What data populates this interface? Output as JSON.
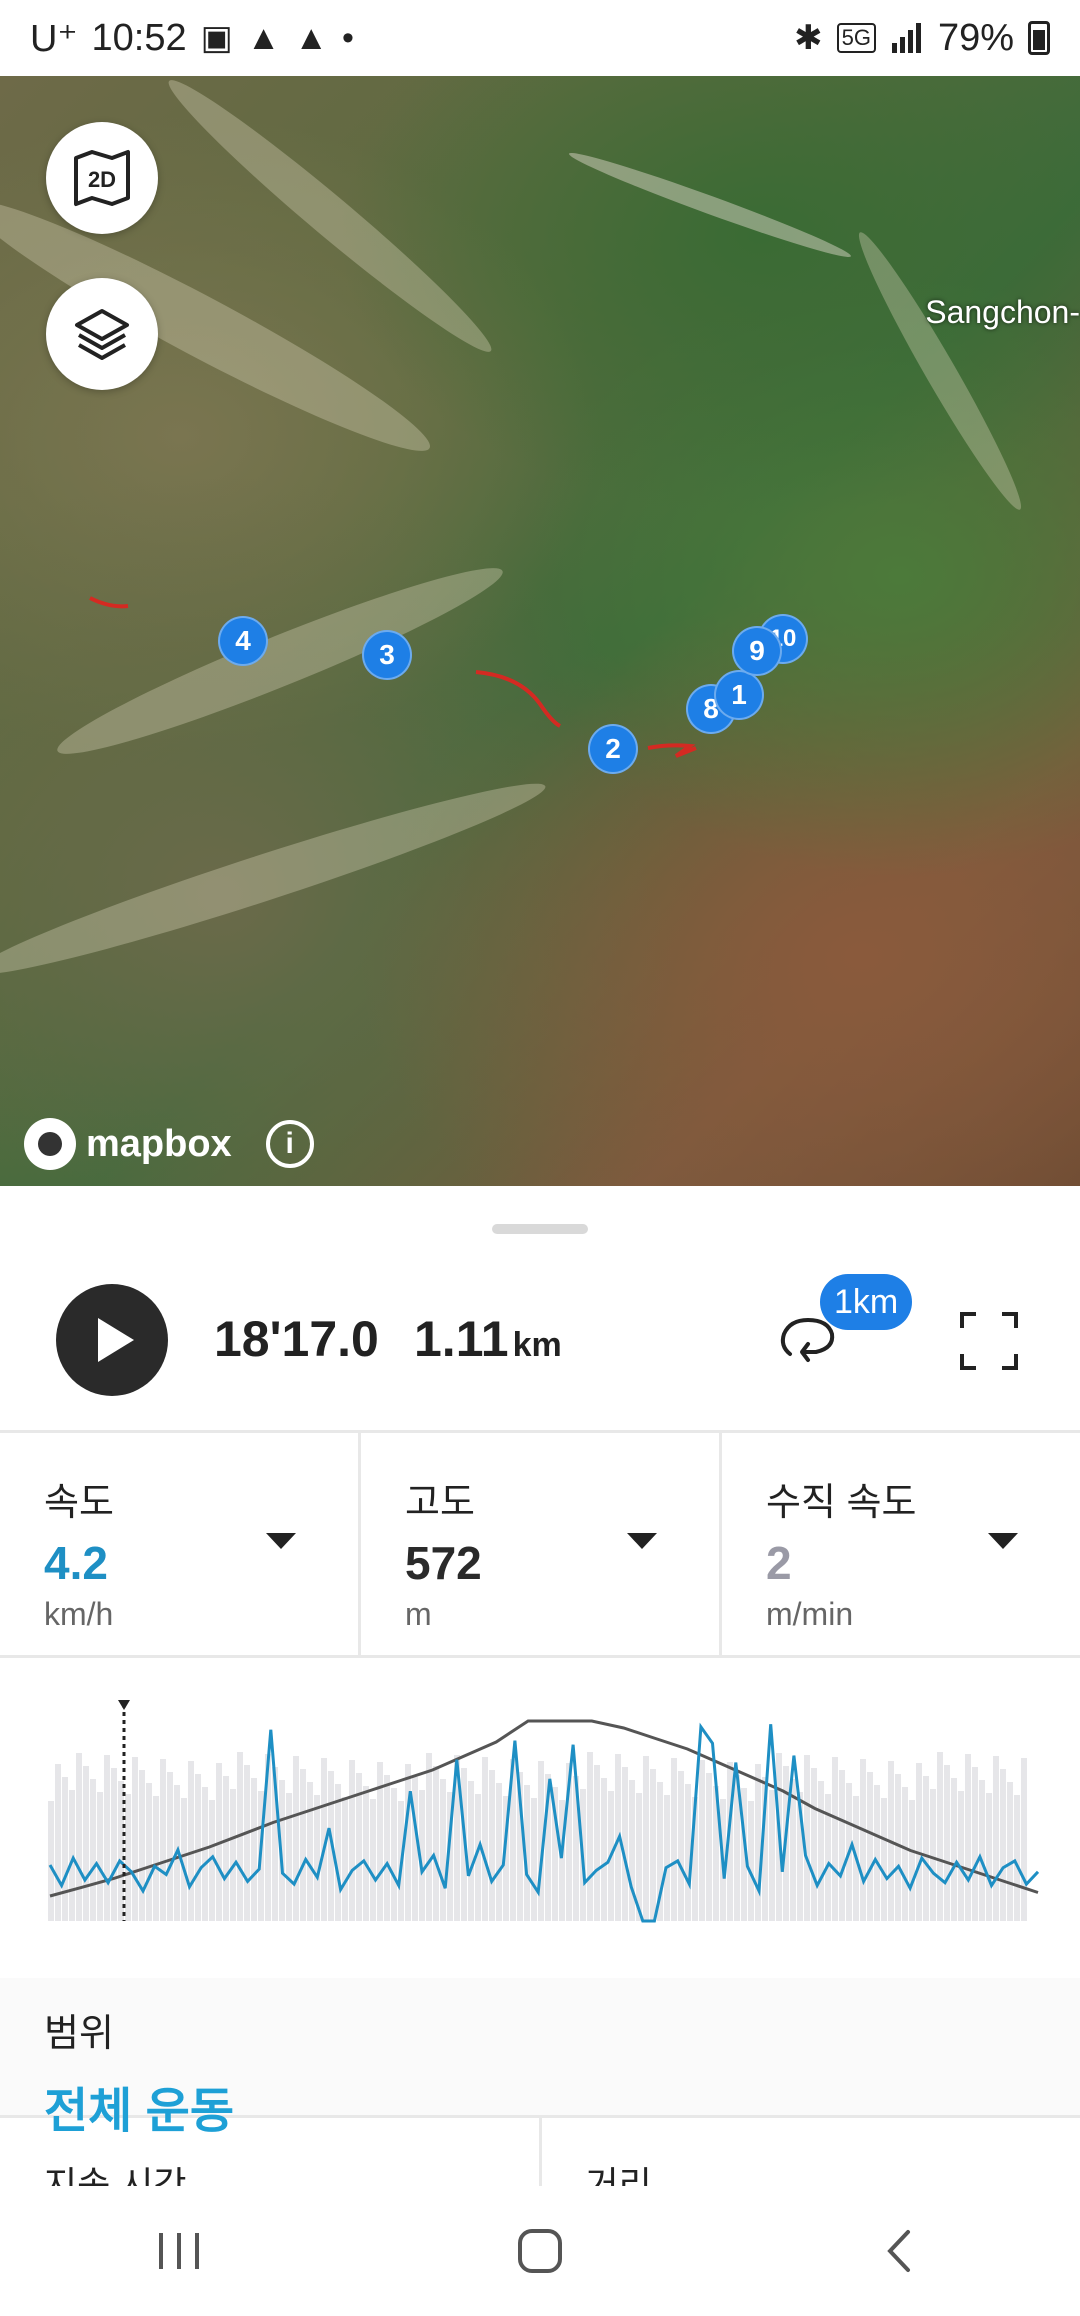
{
  "status_bar": {
    "carrier": "U⁺",
    "time": "10:52",
    "network": "5G",
    "battery": "79%"
  },
  "map": {
    "view_toggle_label": "2D",
    "place_label": "Sangchon-",
    "attribution": "mapbox",
    "waypoints": [
      "4",
      "3",
      "2",
      "8",
      "9",
      "10",
      "1"
    ]
  },
  "playback": {
    "elapsed": "18'17.0",
    "distance_value": "1.11",
    "distance_unit": "km",
    "lap_badge": "1km"
  },
  "metrics": [
    {
      "label": "속도",
      "value": "4.2",
      "unit": "km/h",
      "color": "#1e8fc4"
    },
    {
      "label": "고도",
      "value": "572",
      "unit": "m",
      "color": "#2a2a2a"
    },
    {
      "label": "수직 속도",
      "value": "2",
      "unit": "m/min",
      "color": "#9a9aa6"
    }
  ],
  "range": {
    "label": "범위",
    "value": "전체 운동"
  },
  "summary": {
    "duration_label": "지속 시간",
    "distance_label": "거리"
  },
  "colors": {
    "accent": "#1e7fe6",
    "speed_line": "#1e8fc4",
    "altitude_line": "#555555",
    "route": "#d42a22"
  },
  "chart_data": {
    "type": "line",
    "series": [
      {
        "values": [
          4.1,
          2.6,
          4.6,
          3.0,
          4.2,
          2.8,
          4.4,
          3.6,
          2.2,
          4.0,
          3.4,
          5.2,
          2.5,
          3.9,
          4.7,
          3.1,
          4.3,
          2.9,
          3.8,
          14.0,
          3.5,
          2.7,
          4.5,
          3.2,
          6.8,
          2.3,
          3.7,
          4.4,
          3.0,
          4.2,
          2.6,
          9.5,
          3.6,
          4.8,
          2.4,
          11.8,
          3.3,
          5.6,
          2.9,
          4.1,
          13.2,
          3.4,
          2.1,
          10.4,
          4.6,
          12.9,
          2.8,
          3.7,
          4.3,
          6.2,
          2.5,
          0.0,
          0.0,
          3.9,
          4.4,
          2.7,
          14.2,
          13.0,
          3.1,
          11.6,
          4.0,
          2.2,
          14.4,
          3.6,
          12.1,
          4.8,
          2.6,
          4.2,
          3.3,
          5.6,
          2.9,
          4.5,
          3.1,
          4.0,
          2.4,
          4.6,
          3.5,
          2.8,
          4.3,
          3.0,
          4.7,
          2.6,
          3.9,
          4.4,
          2.7,
          3.6
        ]
      }
    ],
    "altitude": [
      0.0,
      0.05,
      0.1,
      0.16,
      0.22,
      0.28,
      0.35,
      0.42,
      0.48,
      0.54,
      0.6,
      0.66,
      0.72,
      0.8,
      0.88,
      1.0,
      1.0,
      1.0,
      0.96,
      0.9,
      0.84,
      0.76,
      0.68,
      0.6,
      0.5,
      0.42,
      0.34,
      0.26,
      0.2,
      0.14,
      0.08,
      0.02
    ],
    "grid": false
  }
}
